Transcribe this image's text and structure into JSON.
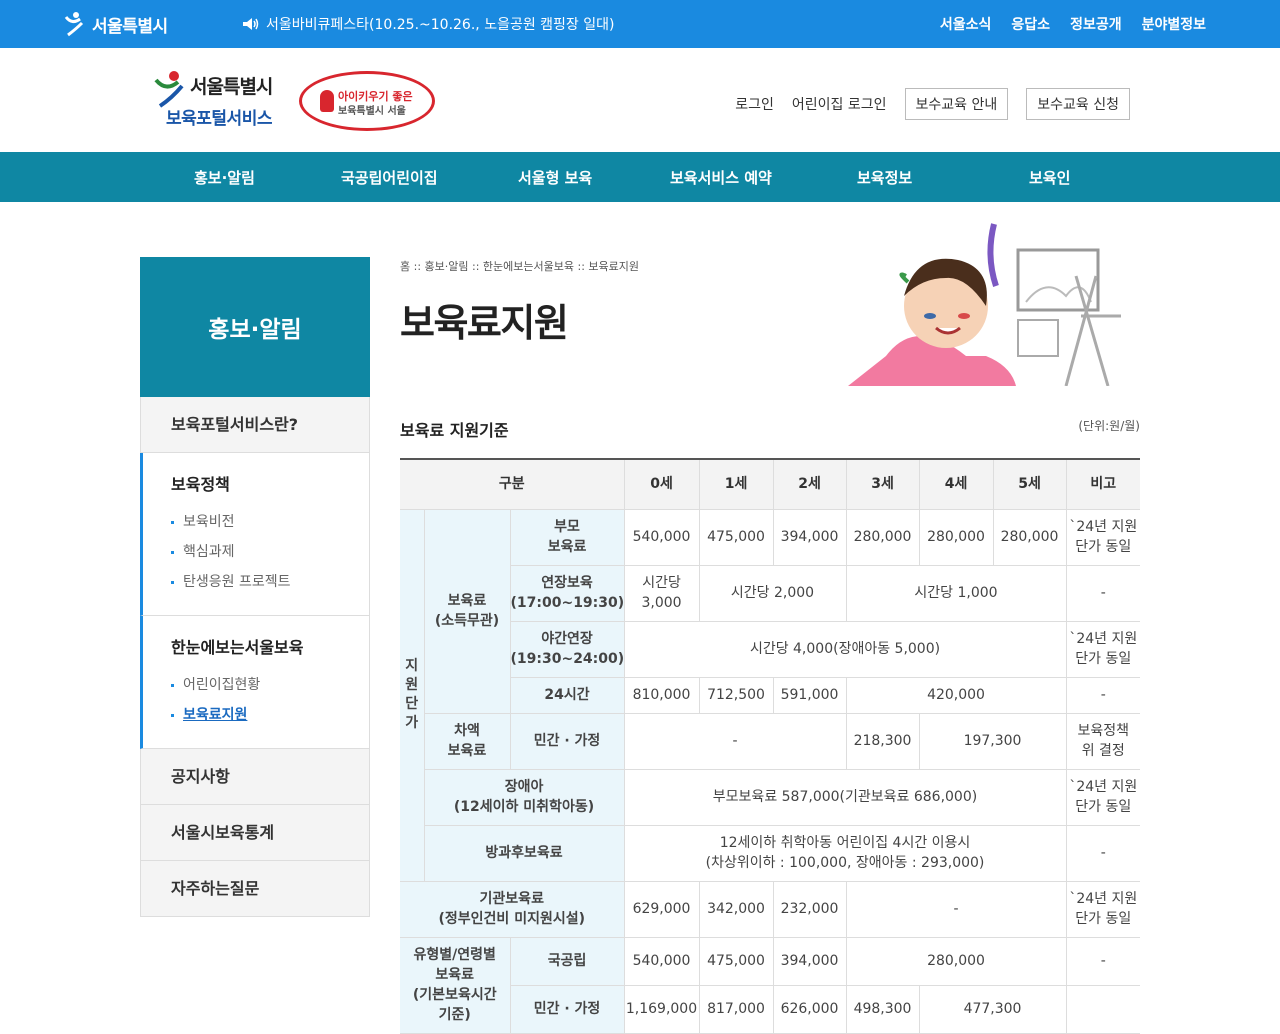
{
  "topbar": {
    "logo": "서울특별시",
    "notice": "서울바비큐페스타(10.25.~10.26., 노을공원 캠핑장 일대)",
    "links": [
      "서울소식",
      "응답소",
      "정보공개",
      "분야별정보"
    ]
  },
  "header": {
    "brand_line1": "서울특별시",
    "brand_line2": "보육포털서비스",
    "badge_line1": "아이키우기 좋은",
    "badge_line2": "보육특별시 서울",
    "login": "로그인",
    "daycare_login": "어린이집 로그인",
    "edu_info": "보수교육 안내",
    "edu_apply": "보수교육 신청"
  },
  "gnb": [
    "홍보·알림",
    "국공립어린이집",
    "서울형 보육",
    "보육서비스 예약",
    "보육정보",
    "보육인"
  ],
  "sidebar": {
    "title": "홍보·알림",
    "menu1": "보육포털서비스란?",
    "group1": {
      "title": "보육정책",
      "items": [
        "보육비전",
        "핵심과제",
        "탄생응원 프로젝트"
      ]
    },
    "group2": {
      "title": "한눈에보는서울보육",
      "items": [
        "어린이집현황",
        "보육료지원"
      ]
    },
    "menu_bottom": [
      "공지사항",
      "서울시보육통계",
      "자주하는질문"
    ]
  },
  "content": {
    "breadcrumb": "홈 :: 홍보·알림 :: 한눈에보는서울보육 :: 보육료지원",
    "title": "보육료지원",
    "section_title": "보육료 지원기준",
    "unit": "(단위:원/월)"
  },
  "table": {
    "headers": [
      "구분",
      "0세",
      "1세",
      "2세",
      "3세",
      "4세",
      "5세",
      "비고"
    ],
    "vert_label": "지원단가",
    "r1": {
      "group": "보육료\n(소득무관)",
      "label": "부모\n보육료",
      "v0": "540,000",
      "v1": "475,000",
      "v2": "394,000",
      "v3": "280,000",
      "v4": "280,000",
      "v5": "280,000",
      "note": "`24년 지원\n단가 동일"
    },
    "r2": {
      "label": "연장보육\n(17:00~19:30)",
      "v0": "시간당\n3,000",
      "v12": "시간당 2,000",
      "v35": "시간당 1,000",
      "note": "-"
    },
    "r3": {
      "label": "야간연장\n(19:30~24:00)",
      "vall": "시간당 4,000(장애아동 5,000)",
      "note": "`24년 지원\n단가 동일"
    },
    "r4": {
      "label": "24시간",
      "v0": "810,000",
      "v1": "712,500",
      "v2": "591,000",
      "v35": "420,000",
      "note": "-"
    },
    "r5": {
      "group": "차액\n보육료",
      "label": "민간 · 가정",
      "v02": "-",
      "v3": "218,300",
      "v45": "197,300",
      "note": "보육정책\n위 결정"
    },
    "r6": {
      "label": "장애아\n(12세이하 미취학아동)",
      "vall": "부모보육료 587,000(기관보육료 686,000)",
      "note": "`24년 지원\n단가 동일"
    },
    "r7": {
      "label": "방과후보육료",
      "vall": "12세이하 취학아동 어린이집 4시간 이용시\n(차상위이하 : 100,000, 장애아동 : 293,000)",
      "note": "-"
    },
    "r8": {
      "label": "기관보육료\n(정부인건비 미지원시설)",
      "v0": "629,000",
      "v1": "342,000",
      "v2": "232,000",
      "v35": "-",
      "note": "`24년 지원\n단가 동일"
    },
    "r9": {
      "group": "유형별/연령별\n보육료\n(기본보육시간\n기준)",
      "label": "국공립",
      "v0": "540,000",
      "v1": "475,000",
      "v2": "394,000",
      "v35": "280,000",
      "note": "-"
    },
    "r10": {
      "label": "민간 · 가정",
      "v0": "1,169,000",
      "v1": "817,000",
      "v2": "626,000",
      "v3": "498,300",
      "v45": "477,300"
    }
  }
}
